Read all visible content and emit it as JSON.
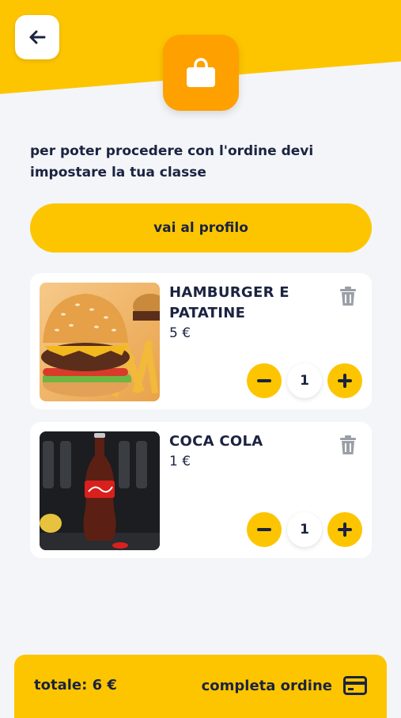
{
  "header": {
    "back_icon": "arrow-left-icon",
    "bag_icon": "shopping-bag-icon",
    "accent": "#fdc500",
    "tile_color": "#fda000"
  },
  "message": {
    "line1": "per poter procedere con l'ordine devi",
    "line2": "impostare la tua classe"
  },
  "profile_button": {
    "label": "vai al profilo"
  },
  "cart": {
    "items": [
      {
        "name_line1": "HAMBURGER E",
        "name_line2": "PATATINE",
        "price": "5 €",
        "quantity": "1",
        "image": "hamburger-fries-photo"
      },
      {
        "name_line1": "COCA COLA",
        "price": "1 €",
        "quantity": "1",
        "image": "coca-cola-bottle-photo"
      }
    ]
  },
  "footer": {
    "total": "totale: 6 €",
    "complete_label": "completa ordine",
    "card_icon": "credit-card-icon"
  }
}
